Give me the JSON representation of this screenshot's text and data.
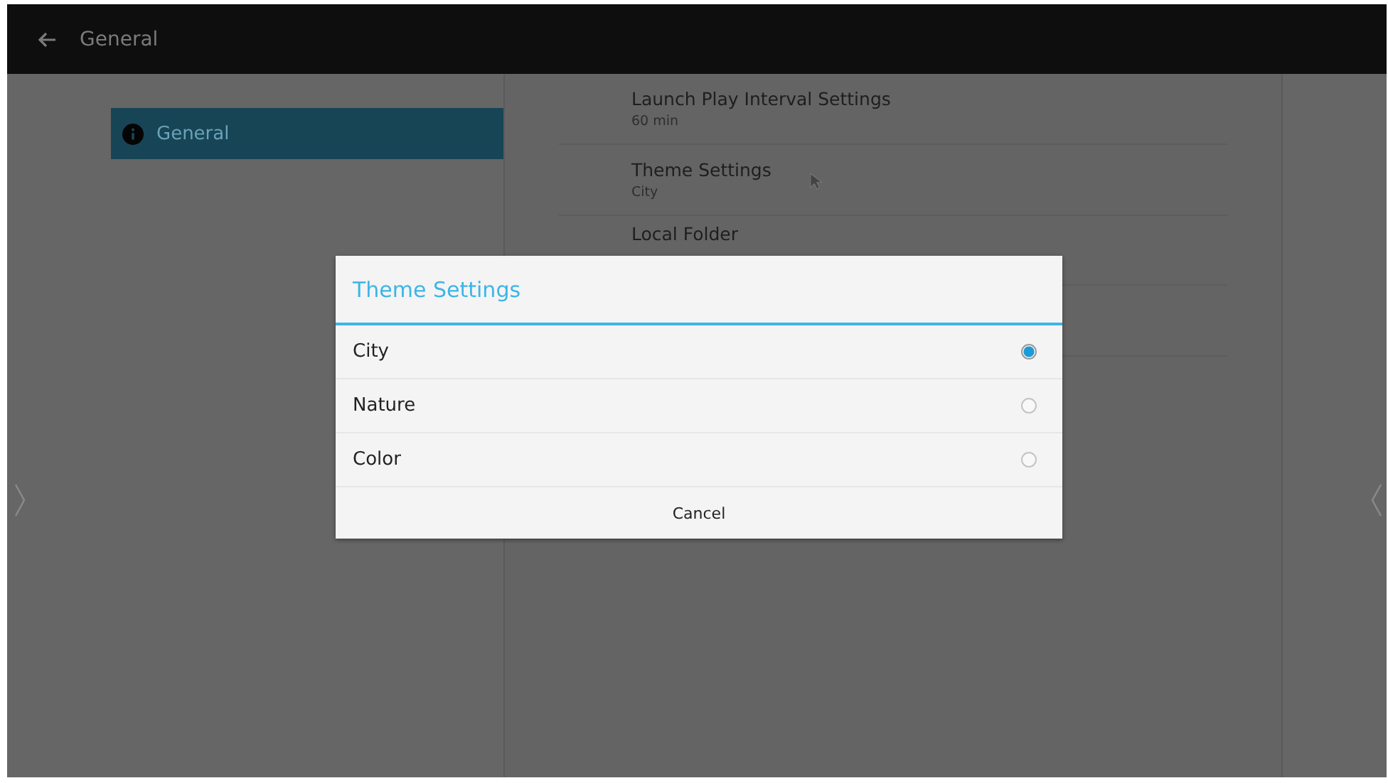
{
  "app_bar": {
    "title": "General"
  },
  "sidebar": {
    "items": [
      {
        "label": "General",
        "selected": true
      }
    ]
  },
  "settings": [
    {
      "title": "Launch Play Interval Settings",
      "value": "60 min"
    },
    {
      "title": "Theme Settings",
      "value": "City"
    },
    {
      "title": "Local Folder"
    }
  ],
  "dialog": {
    "title": "Theme Settings",
    "options": [
      {
        "label": "City",
        "selected": true
      },
      {
        "label": "Nature",
        "selected": false
      },
      {
        "label": "Color",
        "selected": false
      }
    ],
    "buttons": [
      "Cancel"
    ]
  }
}
